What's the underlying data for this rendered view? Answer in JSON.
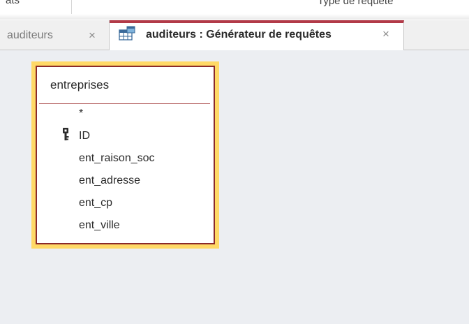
{
  "ribbon": {
    "left_label": "ats",
    "group_label": "Type de requête"
  },
  "tabs": [
    {
      "label": "auditeurs",
      "active": false,
      "close": "×"
    },
    {
      "label": "auditeurs : Générateur de requêtes",
      "active": true,
      "close": "×",
      "icon": "query-design-icon"
    }
  ],
  "table": {
    "name": "entreprises",
    "fields": [
      "*",
      "ID",
      "ent_raison_soc",
      "ent_adresse",
      "ent_cp",
      "ent_ville"
    ],
    "primary_key": "ID"
  },
  "colors": {
    "accent": "#b23a48",
    "selection": "#ffd966",
    "table_border": "#8b2a2a",
    "canvas": "#eceef2"
  }
}
